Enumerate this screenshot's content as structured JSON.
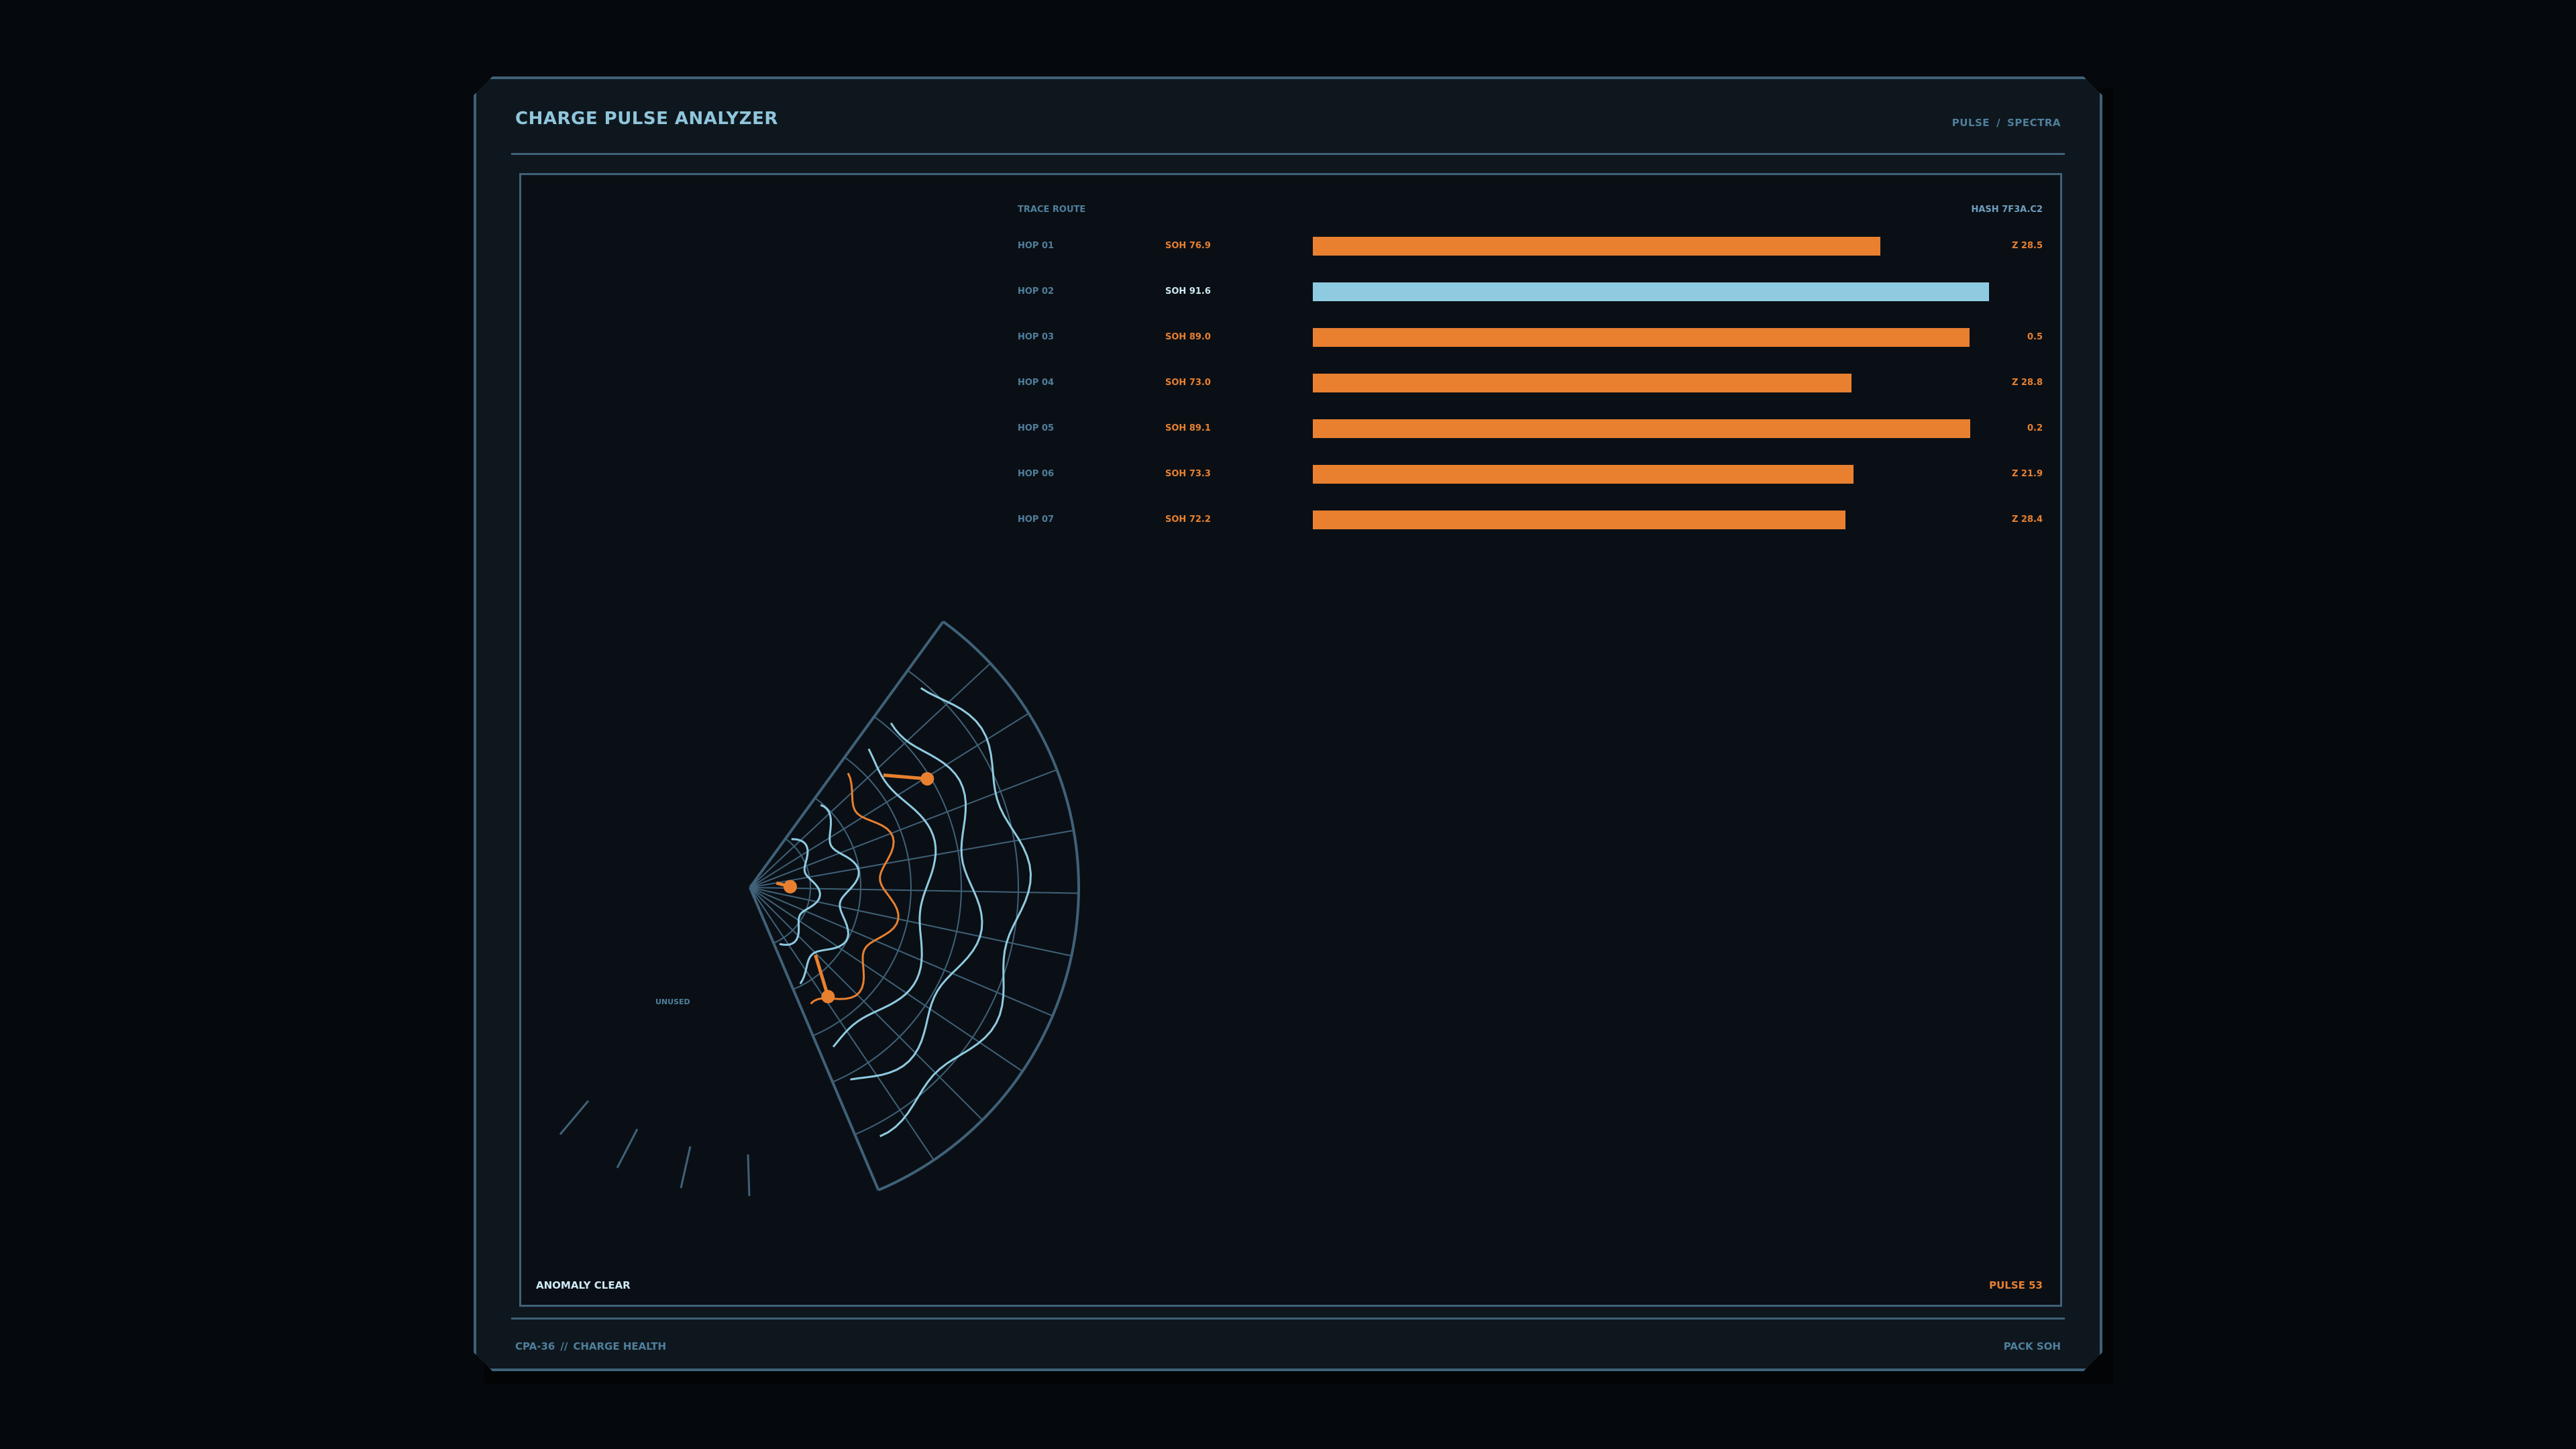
{
  "header": {
    "title": "CHARGE PULSE ANALYZER",
    "nav_left": "PULSE",
    "nav_sep": "/",
    "nav_right": "SPECTRA"
  },
  "footer": {
    "left_a": "CPA-36",
    "left_sep": "//",
    "left_b": "CHARGE HEALTH",
    "right": "PACK SOH"
  },
  "route": {
    "label": "TRACE ROUTE",
    "hash": "HASH 7F3A.C2",
    "max": 100,
    "hops": [
      {
        "hop": "HOP 01",
        "soh": "SOH 76.9",
        "value": 76.9,
        "z": "Z 28.5",
        "highlight": false
      },
      {
        "hop": "HOP 02",
        "soh": "SOH 91.6",
        "value": 91.6,
        "z": "",
        "highlight": true
      },
      {
        "hop": "HOP 03",
        "soh": "SOH 89.0",
        "value": 89.0,
        "z": "0.5",
        "highlight": false
      },
      {
        "hop": "HOP 04",
        "soh": "SOH 73.0",
        "value": 73.0,
        "z": "Z 28.8",
        "highlight": false
      },
      {
        "hop": "HOP 05",
        "soh": "SOH 89.1",
        "value": 89.1,
        "z": "0.2",
        "highlight": false
      },
      {
        "hop": "HOP 06",
        "soh": "SOH 73.3",
        "value": 73.3,
        "z": "Z 21.9",
        "highlight": false
      },
      {
        "hop": "HOP 07",
        "soh": "SOH 72.2",
        "value": 72.2,
        "z": "Z 28.4",
        "highlight": false
      }
    ]
  },
  "status": {
    "anomaly": "ANOMALY CLEAR",
    "pulse": "PULSE 53",
    "unused": "UNUSED"
  },
  "colors": {
    "accent": "#e88030",
    "highlight": "#8fcbe0",
    "grid": "#3f6178"
  }
}
